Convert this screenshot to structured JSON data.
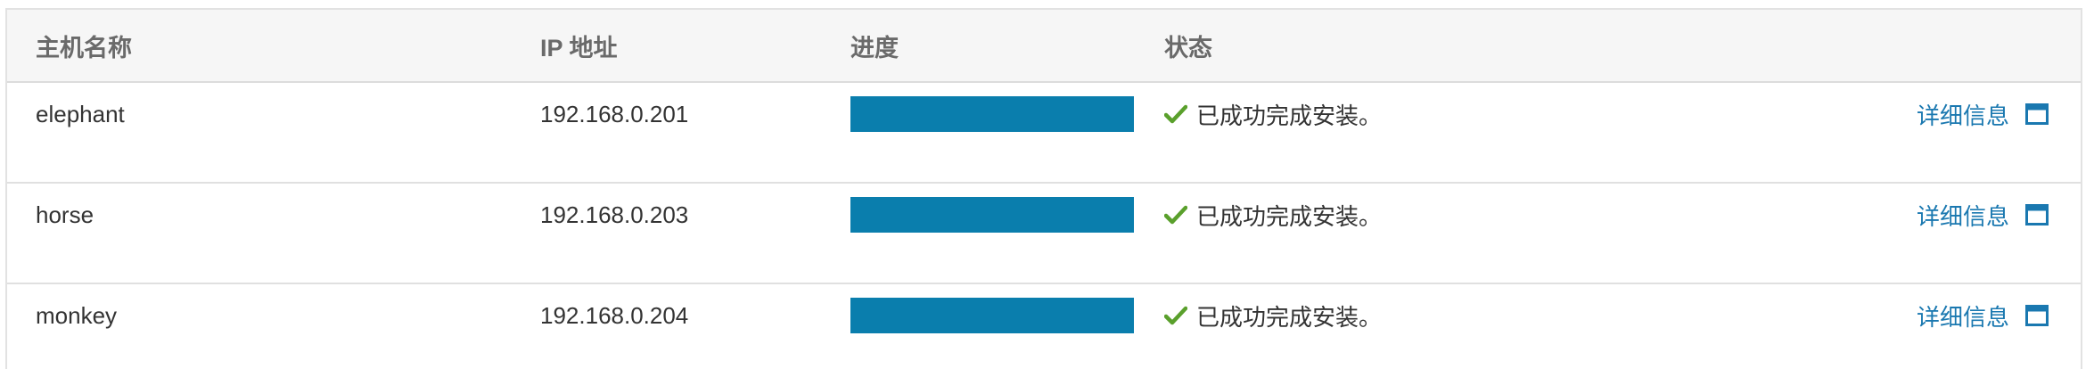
{
  "table": {
    "headers": {
      "host": "主机名称",
      "ip": "IP 地址",
      "progress": "进度",
      "status": "状态"
    },
    "rows": [
      {
        "host": "elephant",
        "ip": "192.168.0.201",
        "progress": 1.0,
        "status": "已成功完成安装。",
        "action": "详细信息"
      },
      {
        "host": "horse",
        "ip": "192.168.0.203",
        "progress": 1.0,
        "status": "已成功完成安装。",
        "action": "详细信息"
      },
      {
        "host": "monkey",
        "ip": "192.168.0.204",
        "progress": 1.0,
        "status": "已成功完成安装。",
        "action": "详细信息"
      }
    ]
  },
  "colors": {
    "progress_fill": "#0a7ead",
    "success_check": "#5aa02c",
    "link": "#1a78b0"
  },
  "icons": {
    "status": "check-icon",
    "detail": "window-icon"
  }
}
